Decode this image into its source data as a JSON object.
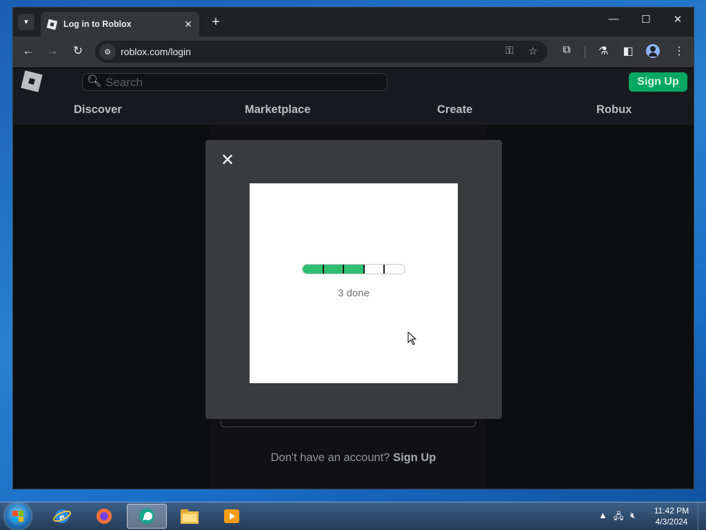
{
  "browser": {
    "tab_title": "Log in to Roblox",
    "tab_close": "✕",
    "new_tab": "+",
    "url": "roblox.com/login",
    "window_controls": {
      "minimize": "—",
      "maximize": "☐",
      "close": "✕"
    }
  },
  "roblox": {
    "search_placeholder": "Search",
    "sign_up_button": "Sign Up",
    "nav": [
      "Discover",
      "Marketplace",
      "Create",
      "Robux"
    ],
    "no_account_text": "Don't have an account?",
    "no_account_link": "Sign Up"
  },
  "modal": {
    "close": "✕",
    "progress": {
      "segments": 5,
      "completed": 3
    },
    "status": "3 done"
  },
  "taskbar": {
    "apps": [
      "internet-explorer",
      "firefox",
      "chat-app",
      "file-explorer",
      "media-player"
    ],
    "clock_time": "11:42 PM",
    "clock_date": "4/3/2024"
  },
  "colors": {
    "signup_green": "#00a760",
    "progress_green": "#2fbf71",
    "modal_bg": "#393b3d",
    "page_bg": "#111214"
  }
}
